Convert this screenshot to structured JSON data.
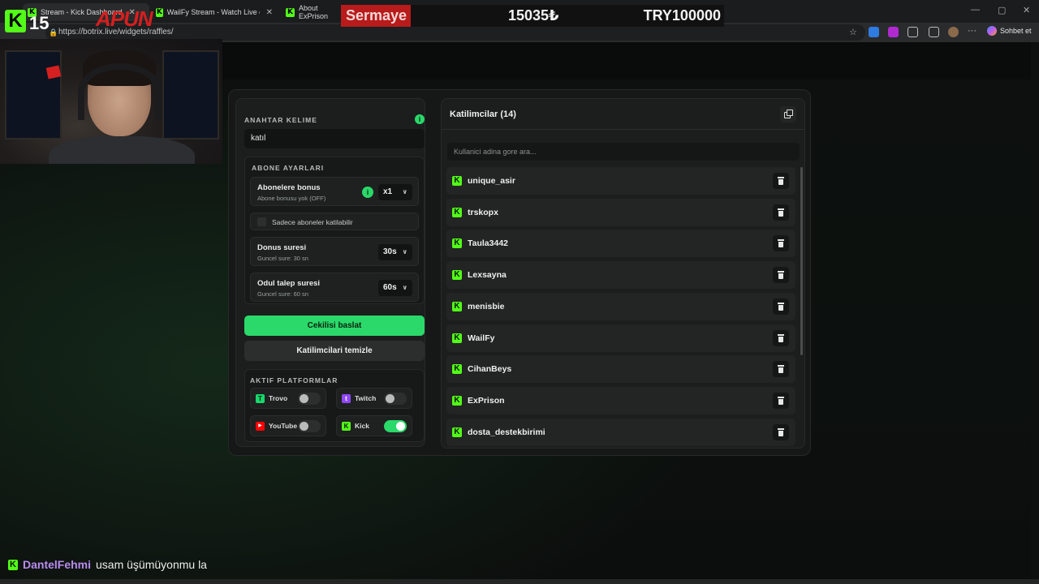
{
  "browser": {
    "tabs": [
      {
        "title": "Stream - Kick Dashboard",
        "active": true
      },
      {
        "title": "WailFy Stream - Watch Live on Kick",
        "active": false
      },
      {
        "title": "About ExPrison",
        "active": false
      }
    ],
    "url": "https://botrix.live/widgets/raffles/",
    "profile_label": "Sohbet et"
  },
  "overlay": {
    "viewer_count": "15",
    "brand_text": "APUN",
    "ticker": {
      "label": "Sermaye",
      "amount": "15035₺",
      "goal": "TRY100000"
    }
  },
  "settings": {
    "keyword_title": "ANAHTAR KELIME",
    "keyword_value": "katıl",
    "abone_title": "ABONE AYARLARI",
    "bonus": {
      "label": "Abonelere bonus",
      "sub": "Abone bonusu yok (OFF)",
      "value": "x1"
    },
    "only_subs_label": "Sadece aboneler katilabilir",
    "bonus_time": {
      "label": "Donus suresi",
      "sub": "Guncel sure: 30 sn",
      "value": "30s"
    },
    "claim_time": {
      "label": "Odul talep suresi",
      "sub": "Guncel sure: 60 sn",
      "value": "60s"
    },
    "start_button": "Cekilisi baslat",
    "clear_button": "Katilimcilari temizle",
    "platforms_title": "AKTIF PLATFORMLAR",
    "platforms": [
      {
        "name": "Trovo",
        "enabled": false,
        "color": "#19d66b"
      },
      {
        "name": "Twitch",
        "enabled": false,
        "color": "#9146ff"
      },
      {
        "name": "YouTube",
        "enabled": false,
        "color": "#ff0000"
      },
      {
        "name": "Kick",
        "enabled": true,
        "color": "#53fc18"
      }
    ]
  },
  "participants": {
    "title": "Katilimcilar (14)",
    "search_placeholder": "Kullanici adina gore ara...",
    "items": [
      "unique_asir",
      "trskopx",
      "Taula3442",
      "Lexsayna",
      "menisbie",
      "WailFy",
      "CihanBeys",
      "ExPrison",
      "dosta_destekbirimi"
    ]
  },
  "chat": {
    "user": "DantelFehmi",
    "message": "usam üşümüyonmu la"
  },
  "colors": {
    "accent": "#2bd96a",
    "kick": "#53fc18",
    "ticker_label": "#b81b1b"
  }
}
